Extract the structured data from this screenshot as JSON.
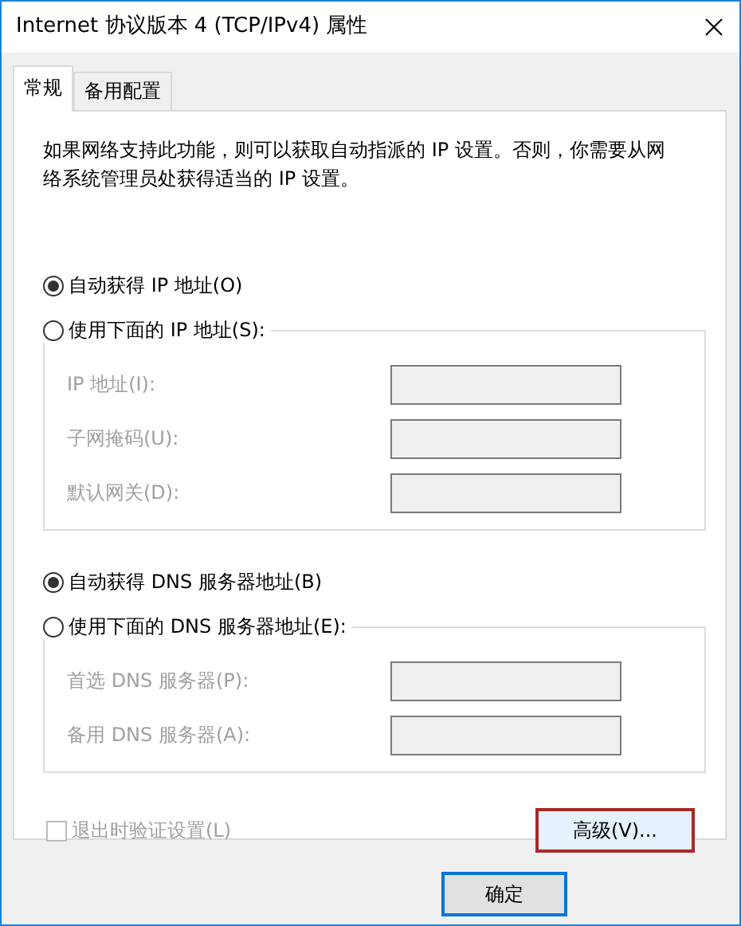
{
  "window": {
    "title": "Internet 协议版本 4 (TCP/IPv4) 属性"
  },
  "tabs": [
    {
      "label": "常规",
      "selected": true
    },
    {
      "label": "备用配置",
      "selected": false
    }
  ],
  "description": "如果网络支持此功能，则可以获取自动指派的 IP 设置。否则，你需要从网络系统管理员处获得适当的 IP 设置。",
  "sections": [
    {
      "options": [
        {
          "label": "自动获得 IP 地址(O)",
          "selected": true
        },
        {
          "label": "使用下面的 IP 地址(S):",
          "selected": false
        }
      ],
      "fields": [
        {
          "label": "IP 地址(I):",
          "disabled": true
        },
        {
          "label": "子网掩码(U):",
          "disabled": true
        },
        {
          "label": "默认网关(D):",
          "disabled": true
        }
      ]
    },
    {
      "options": [
        {
          "label": "自动获得 DNS 服务器地址(B)",
          "selected": true
        },
        {
          "label": "使用下面的 DNS 服务器地址(E):",
          "selected": false
        }
      ],
      "fields": [
        {
          "label": "首选 DNS 服务器(P):",
          "disabled": true
        },
        {
          "label": "备用 DNS 服务器(A):",
          "disabled": true
        }
      ]
    }
  ],
  "verify_on_exit": {
    "label": "退出时验证设置(L)",
    "checked": false,
    "disabled": true
  },
  "advanced_button": "高级(V)...",
  "ok_button": "确定"
}
